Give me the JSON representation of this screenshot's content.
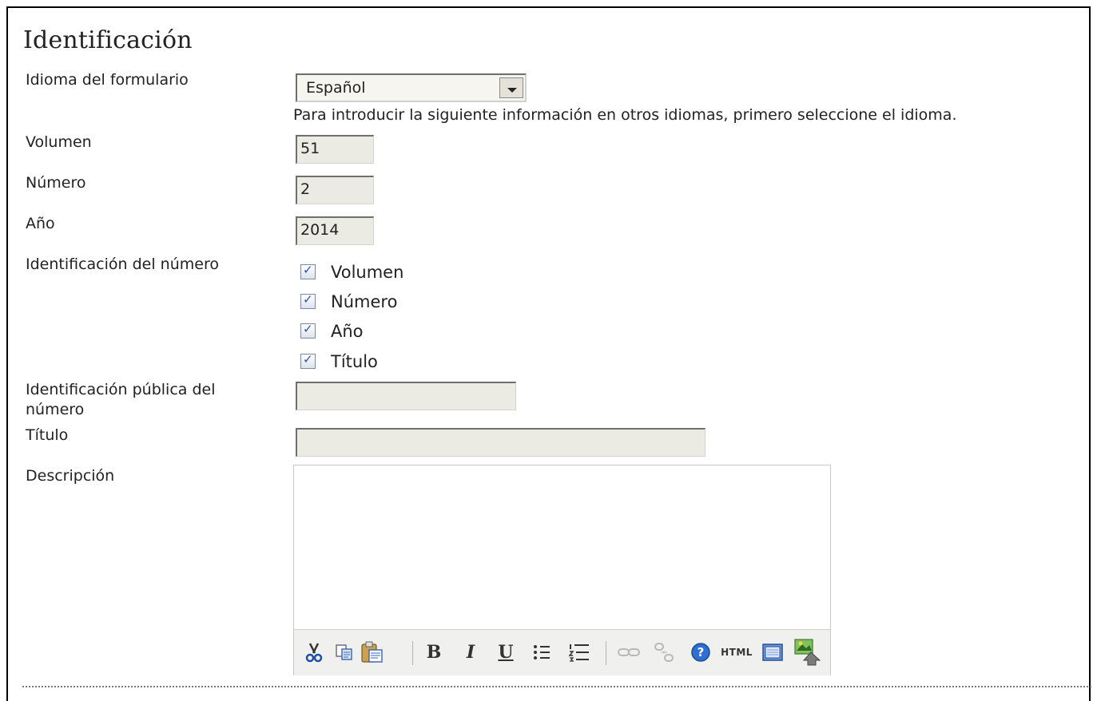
{
  "section": {
    "title": "Identificación"
  },
  "language": {
    "label": "Idioma del formulario",
    "selected": "Español",
    "hint": "Para introducir la siguiente información en otros idiomas, primero seleccione el idioma."
  },
  "fields": {
    "volume": {
      "label": "Volumen",
      "value": "51"
    },
    "number": {
      "label": "Número",
      "value": "2"
    },
    "year": {
      "label": "Año",
      "value": "2014"
    },
    "public_id": {
      "label": "Identificación pública del número",
      "value": ""
    },
    "title": {
      "label": "Título",
      "value": ""
    },
    "description": {
      "label": "Descripción",
      "value": ""
    }
  },
  "identification": {
    "label": "Identificación del número",
    "options": [
      {
        "label": "Volumen",
        "checked": true
      },
      {
        "label": "Número",
        "checked": true
      },
      {
        "label": "Año",
        "checked": true
      },
      {
        "label": "Título",
        "checked": true
      }
    ]
  },
  "toolbar": {
    "buttons": [
      "cut",
      "copy",
      "paste",
      "bold",
      "italic",
      "underline",
      "bullet-list",
      "numbered-list",
      "link",
      "unlink",
      "help",
      "html",
      "fullscreen",
      "image"
    ],
    "bold_glyph": "B",
    "italic_glyph": "I",
    "underline_glyph": "U",
    "html_label": "HTML"
  }
}
